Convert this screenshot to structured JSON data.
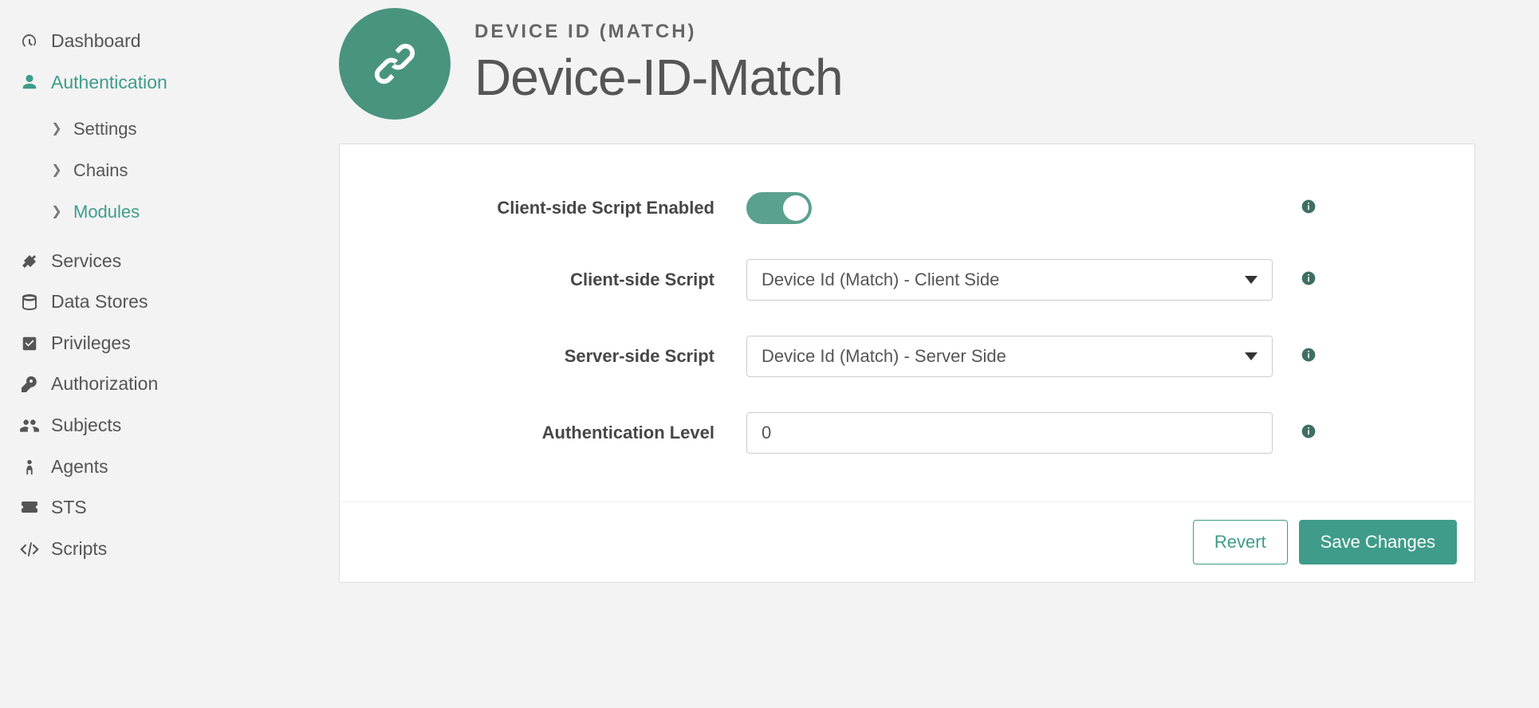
{
  "sidebar": {
    "items": [
      {
        "label": "Dashboard",
        "icon": "dashboard-icon"
      },
      {
        "label": "Authentication",
        "icon": "user-icon",
        "active": true,
        "children": [
          {
            "label": "Settings"
          },
          {
            "label": "Chains"
          },
          {
            "label": "Modules",
            "active": true
          }
        ]
      },
      {
        "label": "Services",
        "icon": "plug-icon"
      },
      {
        "label": "Data Stores",
        "icon": "database-icon"
      },
      {
        "label": "Privileges",
        "icon": "check-square-icon"
      },
      {
        "label": "Authorization",
        "icon": "key-icon"
      },
      {
        "label": "Subjects",
        "icon": "users-icon"
      },
      {
        "label": "Agents",
        "icon": "agent-icon"
      },
      {
        "label": "STS",
        "icon": "ticket-icon"
      },
      {
        "label": "Scripts",
        "icon": "code-icon"
      }
    ]
  },
  "header": {
    "subtitle": "DEVICE ID (MATCH)",
    "title": "Device-ID-Match"
  },
  "form": {
    "client_side_enabled": {
      "label": "Client-side Script Enabled",
      "value": true
    },
    "client_side_script": {
      "label": "Client-side Script",
      "value": "Device Id (Match) - Client Side"
    },
    "server_side_script": {
      "label": "Server-side Script",
      "value": "Device Id (Match) - Server Side"
    },
    "auth_level": {
      "label": "Authentication Level",
      "value": "0"
    }
  },
  "footer": {
    "revert": "Revert",
    "save": "Save Changes"
  }
}
